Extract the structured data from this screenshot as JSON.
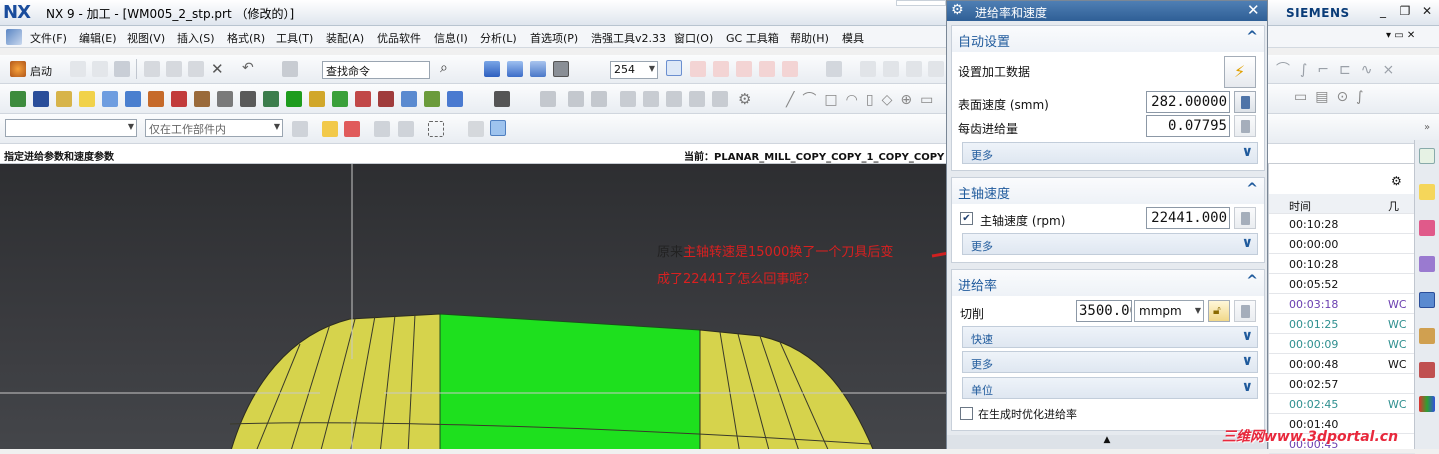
{
  "window": {
    "logo": "NX",
    "title": "NX 9 - 加工 - [WM005_2_stp.prt （修改的）]",
    "brand": "SIEMENS"
  },
  "menu": [
    "文件(F)",
    "编辑(E)",
    "视图(V)",
    "插入(S)",
    "格式(R)",
    "工具(T)",
    "装配(A)",
    "优品软件",
    "信息(I)",
    "分析(L)",
    "首选项(P)",
    "浩强工具v2.33",
    "窗口(O)",
    "GC 工具箱",
    "帮助(H)",
    "模具"
  ],
  "toolbar1": {
    "start_label": "启动",
    "find_cmd": "查找命令",
    "zoom_value": "254"
  },
  "toolbar3": {
    "filter_placeholder": "",
    "scope": "仅在工作部件内"
  },
  "status": {
    "left": "指定进给参数和速度参数",
    "right": "当前：PLANAR_MILL_COPY_COPY_1_COPY_COPY"
  },
  "dialog": {
    "title": "进给率和速度",
    "auto": {
      "header": "自动设置",
      "set_data": "设置加工数据",
      "surface_speed_label": "表面速度 (smm)",
      "surface_speed": "282.00000",
      "feed_per_tooth_label": "每齿进给量",
      "feed_per_tooth": "0.07795",
      "more": "更多"
    },
    "spindle": {
      "header": "主轴速度",
      "speed_label": "主轴速度 (rpm)",
      "speed": "22441.000",
      "checked": true,
      "more": "更多"
    },
    "feed": {
      "header": "进给率",
      "cut_label": "切削",
      "cut_value": "3500.0000",
      "unit": "mmpm",
      "rapid": "快速",
      "more": "更多",
      "units": "单位",
      "optimize_label": "在生成时优化进给率"
    }
  },
  "annotation": {
    "line1_black": "原来",
    "line1_red": "主轴转速是15000换了一个刀具后变",
    "line2_red": "成了22441了怎么回事呢？"
  },
  "timepanel": {
    "col_time": "时间",
    "col_geom": "几",
    "rows": [
      {
        "time": "00:10:28",
        "w": "",
        "style": "normal"
      },
      {
        "time": "00:00:00",
        "w": "",
        "style": "normal"
      },
      {
        "time": "00:10:28",
        "w": "",
        "style": "normal"
      },
      {
        "time": "00:05:52",
        "w": "",
        "style": "normal"
      },
      {
        "time": "00:03:18",
        "w": "WC",
        "style": "purple"
      },
      {
        "time": "00:01:25",
        "w": "WC",
        "style": "teal"
      },
      {
        "time": "00:00:09",
        "w": "WC",
        "style": "teal"
      },
      {
        "time": "00:00:48",
        "w": "WC",
        "style": "normal"
      },
      {
        "time": "00:02:57",
        "w": "",
        "style": "normal"
      },
      {
        "time": "00:02:45",
        "w": "WC",
        "style": "teal"
      },
      {
        "time": "00:01:40",
        "w": "",
        "style": "normal"
      },
      {
        "time": "00:00:45",
        "w": "",
        "style": "purple"
      }
    ]
  },
  "watermark": "三维网www.3dportal.cn",
  "colors": {
    "accent": "#1f5a9c",
    "annotation_red": "#d92020",
    "green_face": "#1ee01e",
    "yellow_face": "#d9d64a"
  }
}
